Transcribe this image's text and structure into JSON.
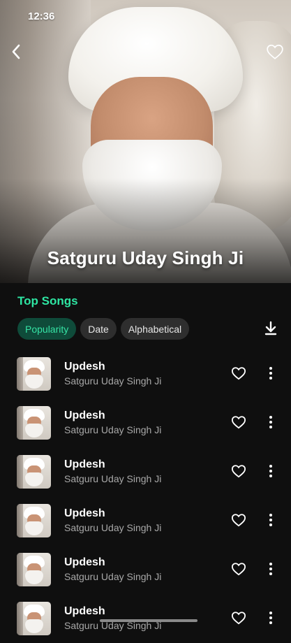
{
  "status": {
    "time": "12:36"
  },
  "header": {
    "artist_name": "Satguru Uday Singh Ji"
  },
  "section": {
    "title": "Top Songs"
  },
  "sort": {
    "options": [
      "Popularity",
      "Date",
      "Alphabetical"
    ],
    "active": "Popularity"
  },
  "icons": {
    "back": "back-arrow-icon",
    "favorite": "heart-outline-icon",
    "download": "download-icon",
    "more": "more-vertical-icon"
  },
  "colors": {
    "accent": "#2ee6a3",
    "chip_active_bg": "#0f4b3a",
    "chip_bg": "#2e2e2e",
    "background": "#0f0f0f"
  },
  "songs": [
    {
      "title": "Updesh",
      "artist": "Satguru Uday Singh Ji"
    },
    {
      "title": "Updesh",
      "artist": "Satguru Uday Singh Ji"
    },
    {
      "title": "Updesh",
      "artist": "Satguru Uday Singh Ji"
    },
    {
      "title": "Updesh",
      "artist": "Satguru Uday Singh Ji"
    },
    {
      "title": "Updesh",
      "artist": "Satguru Uday Singh Ji"
    },
    {
      "title": "Updesh",
      "artist": "Satguru Uday Singh Ji"
    }
  ]
}
